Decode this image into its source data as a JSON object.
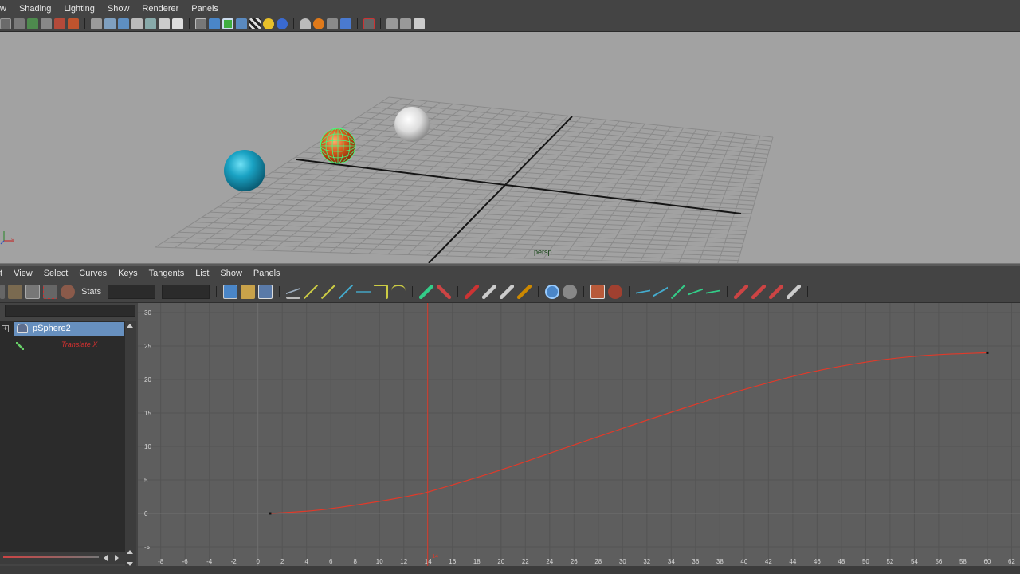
{
  "menu": {
    "items": [
      "w",
      "Shading",
      "Lighting",
      "Show",
      "Renderer",
      "Panels"
    ]
  },
  "viewport": {
    "camera_label": "persp",
    "colors": {
      "background": "#a2a2a2",
      "grid": "#8a8a8a",
      "axis": "#151515",
      "sphere_blue": "#1aa3c4",
      "sphere_white": "#dcdcdc",
      "sphere_selected": "#d65a1c",
      "selection_wire": "#40ff80"
    }
  },
  "graph_editor": {
    "menu": [
      "t",
      "View",
      "Select",
      "Curves",
      "Keys",
      "Tangents",
      "List",
      "Show",
      "Panels"
    ],
    "stats_label": "Stats",
    "outliner": {
      "object": "pSphere2",
      "attribute": "Translate X"
    },
    "current_frame_label": "14",
    "axis": {
      "x_ticks": [
        "-8",
        "-6",
        "-4",
        "-2",
        "0",
        "2",
        "4",
        "6",
        "8",
        "10",
        "12",
        "14",
        "16",
        "18",
        "20",
        "22",
        "24",
        "26",
        "28",
        "30",
        "32",
        "34",
        "36",
        "38",
        "40",
        "42",
        "44",
        "46",
        "48",
        "50",
        "52",
        "54",
        "56",
        "58",
        "60",
        "62"
      ],
      "y_ticks": [
        "30",
        "25",
        "20",
        "15",
        "10",
        "5",
        "0",
        "-5"
      ]
    },
    "curve_color": "#e03a2a",
    "current_frame_color": "#e03a2a"
  },
  "chart_data": {
    "type": "line",
    "series": [
      {
        "name": "Translate X",
        "keys": [
          {
            "frame": 1,
            "value": 0
          },
          {
            "frame": 60,
            "value": 24
          }
        ],
        "x": [
          1,
          5,
          10,
          13,
          14,
          20,
          25,
          30,
          35,
          40,
          45,
          50,
          55,
          60
        ],
        "values": [
          0,
          0.5,
          1.8,
          2.8,
          3.2,
          6.5,
          9.6,
          12.7,
          15.7,
          18.5,
          20.9,
          22.6,
          23.6,
          24
        ]
      }
    ],
    "current_frame": 14,
    "xlim": [
      -9,
      63
    ],
    "ylim": [
      -6,
      31
    ]
  }
}
